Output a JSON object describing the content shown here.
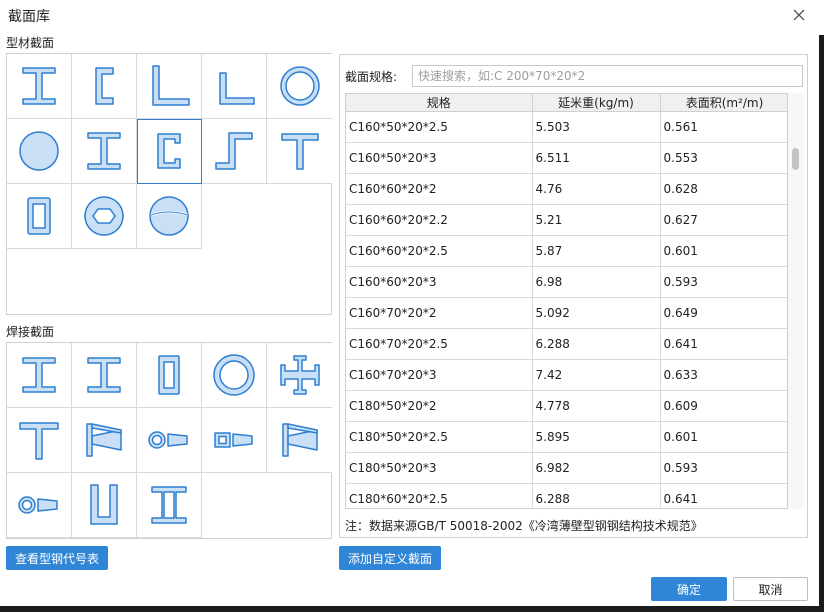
{
  "dialog": {
    "title": "截面库"
  },
  "sections": {
    "profile_label": "型材截面",
    "welded_label": "焊接截面"
  },
  "profile_shapes": [
    "i-beam-icon",
    "channel-icon",
    "equal-angle-icon",
    "unequal-angle-icon",
    "circular-tube-icon",
    "round-bar-icon",
    "i-beam-icon",
    "lipped-channel-icon",
    "z-section-icon",
    "t-section-icon",
    "rect-tube-icon",
    "hexagon-bar-icon",
    "hemisphere-icon"
  ],
  "welded_shapes": [
    "welded-i-icon",
    "welded-i-icon",
    "box-section-icon",
    "ring-icon",
    "cross-section-icon",
    "welded-t-icon",
    "tapered-i-icon",
    "tapered-tube-icon",
    "tapered-box-icon",
    "tapered-i-icon",
    "tapered-tube-icon",
    "u-section-icon",
    "double-channel-icon"
  ],
  "selected_profile_index": 7,
  "search": {
    "label": "截面规格:",
    "placeholder": "快速搜索，如:C 200*70*20*2",
    "value": ""
  },
  "table": {
    "headers": [
      "规格",
      "延米重(kg/m)",
      "表面积(m²/m)"
    ],
    "rows": [
      [
        "C160*50*20*2.5",
        "5.503",
        "0.561"
      ],
      [
        "C160*50*20*3",
        "6.511",
        "0.553"
      ],
      [
        "C160*60*20*2",
        "4.76",
        "0.628"
      ],
      [
        "C160*60*20*2.2",
        "5.21",
        "0.627"
      ],
      [
        "C160*60*20*2.5",
        "5.87",
        "0.601"
      ],
      [
        "C160*60*20*3",
        "6.98",
        "0.593"
      ],
      [
        "C160*70*20*2",
        "5.092",
        "0.649"
      ],
      [
        "C160*70*20*2.5",
        "6.288",
        "0.641"
      ],
      [
        "C160*70*20*3",
        "7.42",
        "0.633"
      ],
      [
        "C180*50*20*2",
        "4.778",
        "0.609"
      ],
      [
        "C180*50*20*2.5",
        "5.895",
        "0.601"
      ],
      [
        "C180*50*20*3",
        "6.982",
        "0.593"
      ],
      [
        "C180*60*20*2.5",
        "6.288",
        "0.641"
      ]
    ]
  },
  "note": "注：数据来源GB/T 50018-2002《冷湾薄壁型钢钢结构技术规范》",
  "buttons": {
    "view_codes": "查看型钢代号表",
    "add_custom": "添加自定义截面",
    "ok": "确定",
    "cancel": "取消"
  },
  "colors": {
    "accent": "#2f86d6",
    "icon_fill": "#c9dff5",
    "icon_stroke": "#2e7fd0"
  }
}
